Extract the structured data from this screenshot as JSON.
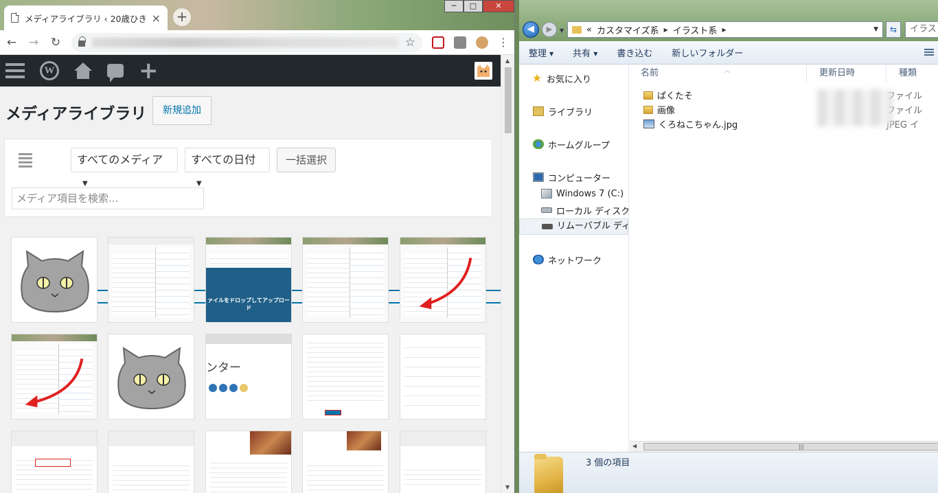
{
  "chrome": {
    "tab_title": "メディアライブラリ ‹ 20歳ひき",
    "tab_close": "×",
    "new_tab": "+",
    "window_controls": {
      "minimize": "─",
      "maximize": "□",
      "close": "✕"
    },
    "nav": {
      "back": "←",
      "forward": "→",
      "reload": "↻"
    },
    "bookmark_star": "☆",
    "menu": "⋮"
  },
  "wp": {
    "admin_bar_icons": [
      "menu-icon",
      "wordpress-logo",
      "home-icon",
      "comments-icon",
      "new-content-icon"
    ],
    "page_title": "メディアライブラリ",
    "add_new": "新規追加",
    "filter_type": "すべてのメディア",
    "filter_date": "すべての日付",
    "bulk_select": "一括選択",
    "search_placeholder": "メディア項目を検索...",
    "thumbnail_texts": {
      "drop_upload": "ァイルをドロップしてアップロード",
      "counter_heading": "ンター"
    }
  },
  "explorer": {
    "breadcrumb_prefix": "«",
    "breadcrumb": [
      "カスタマイズ系",
      "イラスト系"
    ],
    "search_placeholder": "イラス",
    "commands": [
      "整理",
      "共有",
      "書き込む",
      "新しいフォルダー"
    ],
    "nav": [
      {
        "label": "お気に入り",
        "icon": "favorites-star-icon"
      },
      {
        "label": "ライブラリ",
        "icon": "libraries-icon"
      },
      {
        "label": "ホームグループ",
        "icon": "homegroup-icon"
      },
      {
        "label": "コンピューター",
        "icon": "computer-icon"
      },
      {
        "label": "Windows 7 (C:)",
        "icon": "windows-drive-icon"
      },
      {
        "label": "ローカル ディスク (",
        "icon": "local-disk-icon"
      },
      {
        "label": "リムーバブル ディス",
        "icon": "removable-disk-icon"
      },
      {
        "label": "ネットワーク",
        "icon": "network-icon"
      }
    ],
    "columns": [
      "名前",
      "更新日時",
      "種類"
    ],
    "files": [
      {
        "name": "ぱくたそ",
        "type": "ファイル",
        "icon": "folder-icon"
      },
      {
        "name": "画像",
        "type": "ファイル",
        "icon": "folder-icon"
      },
      {
        "name": "くろねこちゃん.jpg",
        "type": "JPEG イ",
        "icon": "jpeg-image-icon"
      }
    ],
    "status": "3 個の項目"
  }
}
